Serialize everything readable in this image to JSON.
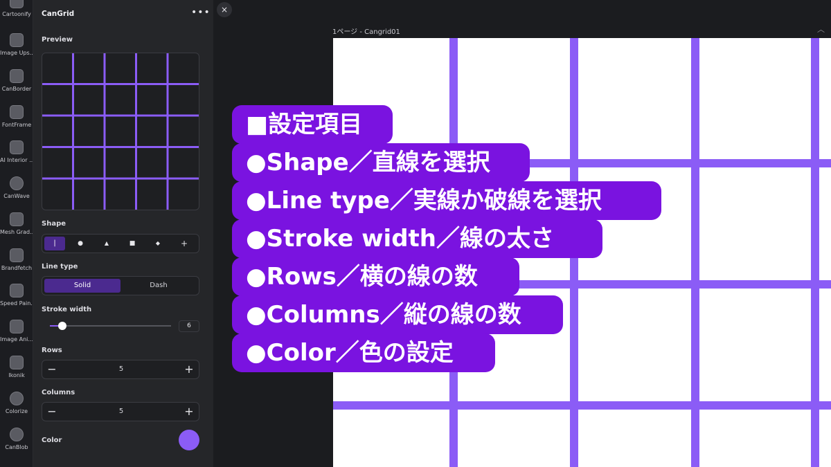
{
  "rail": {
    "items": [
      {
        "label": "Cartoonify",
        "icon": "cartoonify-icon"
      },
      {
        "label": "Image Ups...",
        "icon": "image-upscale-icon"
      },
      {
        "label": "CanBorder",
        "icon": "canborder-icon"
      },
      {
        "label": "FontFrame",
        "icon": "fontframe-icon"
      },
      {
        "label": "AI Interior ...",
        "icon": "ai-interior-icon"
      },
      {
        "label": "CanWave",
        "icon": "canwave-icon"
      },
      {
        "label": "Mesh Grad...",
        "icon": "mesh-gradient-icon"
      },
      {
        "label": "Brandfetch",
        "icon": "brandfetch-icon"
      },
      {
        "label": "Speed Pain...",
        "icon": "speed-paint-icon"
      },
      {
        "label": "Image Ani...",
        "icon": "image-animate-icon"
      },
      {
        "label": "Ikonik",
        "icon": "ikonik-icon"
      },
      {
        "label": "Colorize",
        "icon": "colorize-icon"
      },
      {
        "label": "CanBlob",
        "icon": "canblob-icon"
      }
    ]
  },
  "panel": {
    "title": "CanGrid",
    "preview_label": "Preview",
    "shape": {
      "label": "Shape",
      "options": [
        {
          "glyph": "|",
          "name": "line",
          "selected": true
        },
        {
          "glyph": "●",
          "name": "circle",
          "selected": false
        },
        {
          "glyph": "▲",
          "name": "triangle",
          "selected": false
        },
        {
          "glyph": "■",
          "name": "square",
          "selected": false
        },
        {
          "glyph": "◆",
          "name": "diamond",
          "selected": false
        },
        {
          "glyph": "+",
          "name": "plus",
          "selected": false
        }
      ]
    },
    "line_type": {
      "label": "Line type",
      "options": [
        {
          "label": "Solid",
          "selected": true
        },
        {
          "label": "Dash",
          "selected": false
        }
      ]
    },
    "stroke_width": {
      "label": "Stroke width",
      "value": "6",
      "fraction": 0.1
    },
    "rows": {
      "label": "Rows",
      "value": "5",
      "minus": "−",
      "plus": "+"
    },
    "columns": {
      "label": "Columns",
      "value": "5",
      "minus": "−",
      "plus": "+"
    },
    "color": {
      "label": "Color",
      "value": "#8b5cf6"
    }
  },
  "canvas": {
    "close": "×",
    "page_label": "1ページ - Cangrid01",
    "grid_color": "#8b5cf6"
  },
  "overlay": {
    "lines": [
      "■設定項目",
      "●Shape／直線を選択",
      "●Line type／実線か破線を選択",
      "●Stroke width／線の太さ",
      "●Rows／横の線の数",
      "●Columns／縦の線の数",
      "●Color／色の設定"
    ],
    "bg_color": "#7a13e0"
  }
}
